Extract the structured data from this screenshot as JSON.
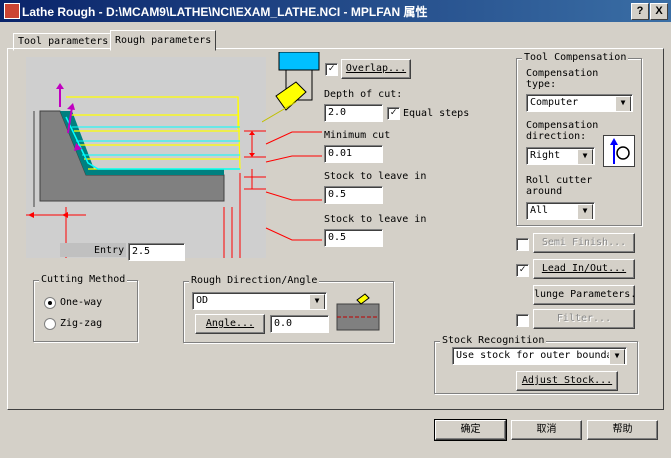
{
  "window": {
    "title": "Lathe Rough - D:\\MCAM9\\LATHE\\NCI\\EXAM_LATHE.NCI - MPLFAN 属性",
    "help_button": "?",
    "close_button": "X"
  },
  "tabs": [
    {
      "label": "Tool parameters"
    },
    {
      "label": "Rough parameters"
    }
  ],
  "rough": {
    "overlap_label": "Overlap...",
    "depth_label": "Depth of cut:",
    "depth_value": "2.0",
    "equal_steps_label": "Equal steps",
    "min_cut_label": "Minimum cut",
    "min_cut_value": "0.01",
    "stock_x_label": "Stock to leave in",
    "stock_x_value": "0.5",
    "stock_z_label": "Stock to leave in",
    "stock_z_value": "0.5",
    "entry_label": "Entry",
    "entry_value": "2.5"
  },
  "cutting_method": {
    "title": "Cutting Method",
    "options": [
      {
        "label": "One-way",
        "selected": true
      },
      {
        "label": "Zig-zag",
        "selected": false
      }
    ]
  },
  "rough_direction": {
    "title": "Rough Direction/Angle",
    "direction_value": "OD",
    "angle_button": "Angle...",
    "angle_value": "0.0"
  },
  "tool_comp": {
    "title": "Tool Compensation",
    "comp_type_label": "Compensation type:",
    "comp_type_value": "Computer",
    "comp_dir_label": "Compensation direction:",
    "comp_dir_value": "Right",
    "roll_label": "Roll cutter around",
    "roll_value": "All"
  },
  "options": {
    "semi_finish": {
      "label": "Semi Finish...",
      "checked": false,
      "enabled": false
    },
    "lead_in_out": {
      "label": "Lead In/Out...",
      "checked": true,
      "enabled": true
    },
    "plunge": {
      "label": "lunge Parameters..."
    },
    "filter": {
      "label": "Filter...",
      "checked": false,
      "enabled": false
    }
  },
  "stock_recognition": {
    "title": "Stock Recognition",
    "value": "Use stock for outer boundar",
    "adjust_button": "Adjust Stock..."
  },
  "footer": {
    "ok": "确定",
    "cancel": "取消",
    "help": "帮助"
  },
  "colors": {
    "dialog_bg": "#d4d0c8",
    "title_bar": "#0a246a",
    "part_fill": "#008080",
    "yellow_path": "#ffff00",
    "cyan_path": "#00ffff",
    "magenta_arrow": "#c000c0",
    "dimension_red": "#ff0000",
    "tool_blue": "#00c0ff"
  }
}
